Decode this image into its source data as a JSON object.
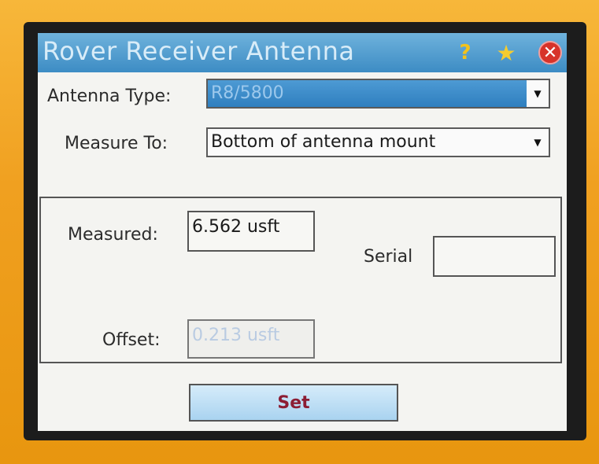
{
  "window": {
    "title": "Rover Receiver Antenna",
    "icons": [
      "help-icon",
      "favorites-icon",
      "close-icon"
    ]
  },
  "form": {
    "antenna_type_label": "Antenna Type:",
    "antenna_type_value": "R8/5800",
    "measure_to_label": "Measure To:",
    "measure_to_value": "Bottom of antenna mount",
    "measured_label": "Measured:",
    "measured_value": "6.562 usft",
    "serial_label": "Serial",
    "serial_value": "",
    "offset_label": "Offset:",
    "offset_value": "0.213 usft",
    "set_label": "Set"
  },
  "colors": {
    "title_bar": "#3d8cc4",
    "set_text": "#8c1d33",
    "device_body": "#f0a020"
  }
}
